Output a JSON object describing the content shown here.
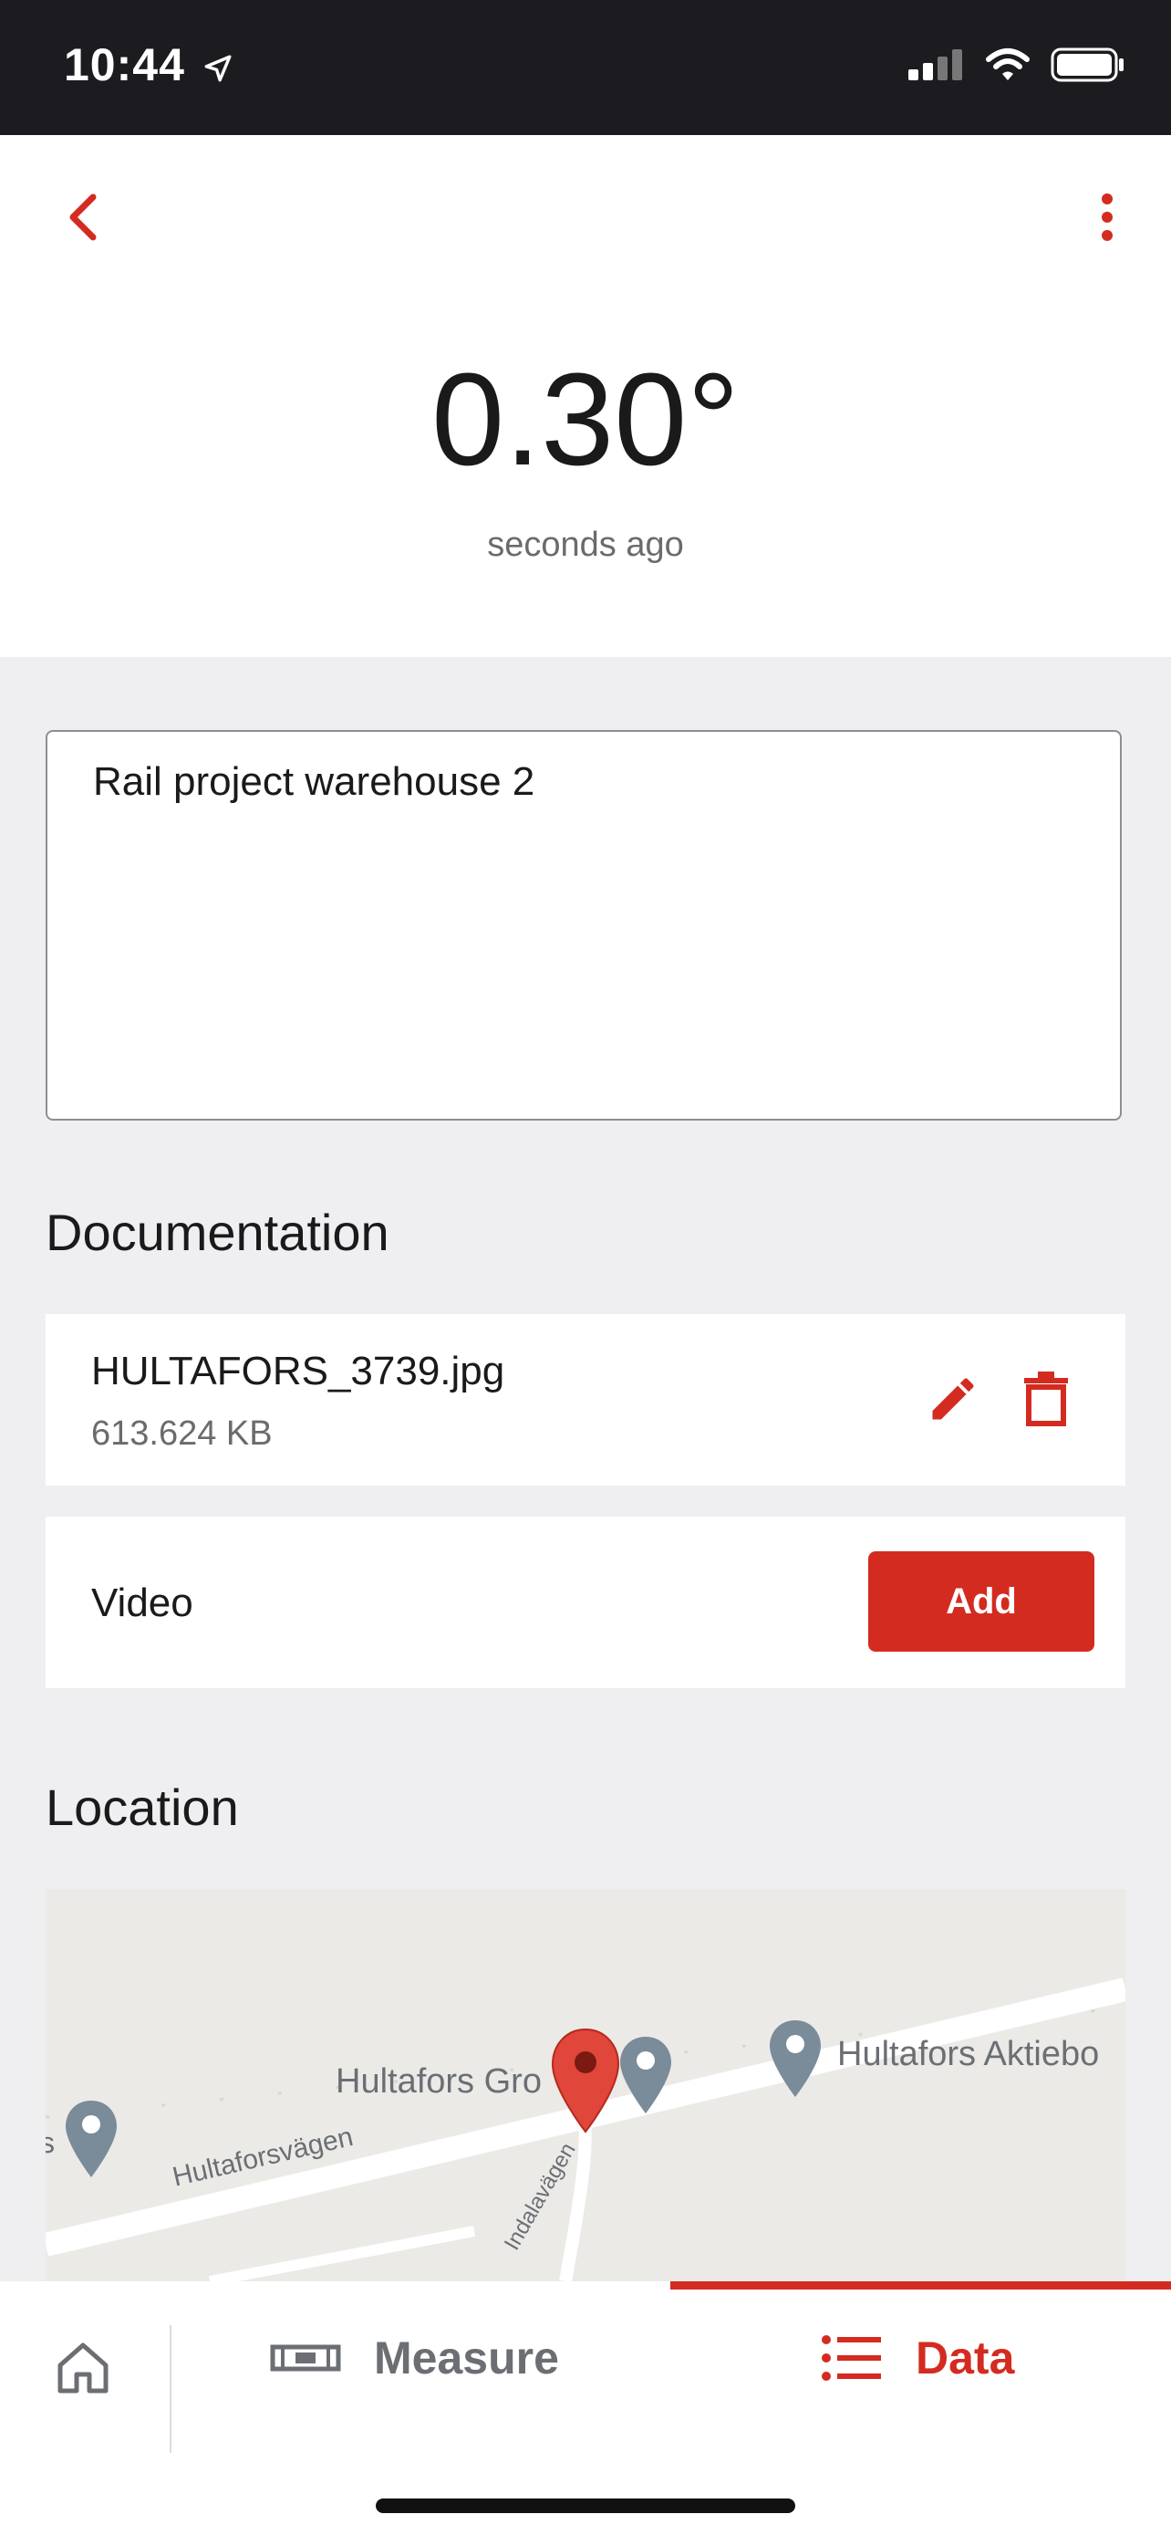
{
  "status_bar": {
    "time": "10:44"
  },
  "header": {
    "value": "0.30°",
    "subtitle": "seconds ago"
  },
  "note": {
    "text": "Rail project warehouse 2"
  },
  "documentation": {
    "title": "Documentation",
    "file": {
      "name": "HULTAFORS_3739.jpg",
      "size": "613.624 KB"
    },
    "video": {
      "label": "Video",
      "add_label": "Add"
    }
  },
  "location": {
    "title": "Location",
    "map_labels": {
      "place1": "Hultafors Gro",
      "place2": "Hultafors Aktiebo",
      "road1": "Hultaforsvägen",
      "road2": "Indalavägen",
      "edge": "s"
    }
  },
  "tabs": {
    "measure": "Measure",
    "data": "Data"
  },
  "colors": {
    "accent": "#d42b20",
    "inactive": "#6b6f74"
  }
}
